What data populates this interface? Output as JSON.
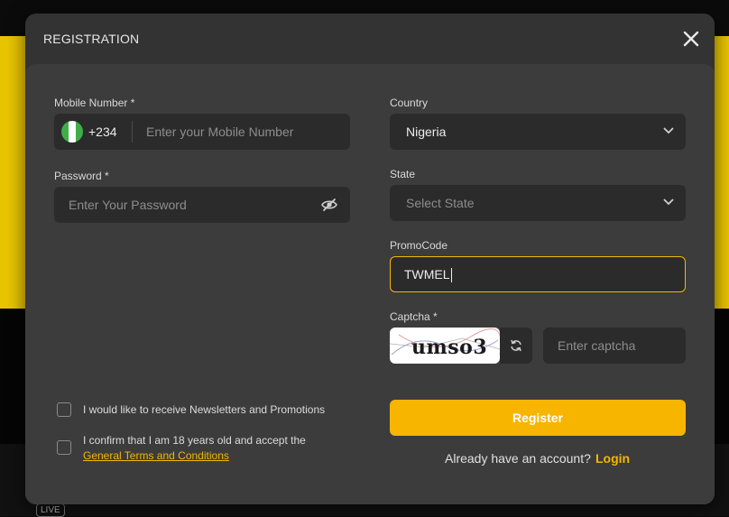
{
  "modal": {
    "title": "REGISTRATION",
    "close_icon": "close-icon"
  },
  "mobile": {
    "label": "Mobile Number *",
    "country_code": "+234",
    "placeholder": "Enter your Mobile Number",
    "flag_colors": [
      "#3fae49",
      "#ffffff",
      "#3fae49"
    ]
  },
  "password": {
    "label": "Password *",
    "placeholder": "Enter Your Password",
    "toggle_icon": "eye-off-icon"
  },
  "country": {
    "label": "Country",
    "selected": "Nigeria"
  },
  "state": {
    "label": "State",
    "selected": "Select State"
  },
  "promo": {
    "label": "PromoCode",
    "value": "TWMEL"
  },
  "captcha": {
    "label": "Captcha *",
    "image_text": "umso3",
    "placeholder": "Enter captcha",
    "refresh_icon": "refresh-icon"
  },
  "checkboxes": {
    "newsletter": "I would like to receive Newsletters and Promotions",
    "terms_prefix": "I confirm that I am 18 years old and accept the",
    "terms_link": "General Terms and Conditions"
  },
  "actions": {
    "register": "Register",
    "already": "Already have an account?",
    "login": "Login"
  },
  "colors": {
    "accent": "#f7b500",
    "modal_bg": "#333333",
    "field_bg": "#2b2b2b"
  },
  "background": {
    "live_badge": "LIVE"
  }
}
